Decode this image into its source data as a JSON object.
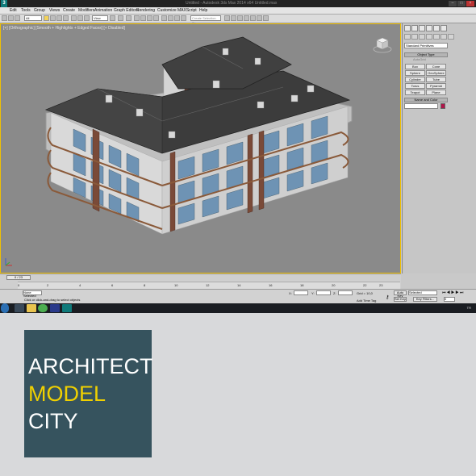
{
  "titlebar": {
    "text": "Untitled - Autodesk 3ds Max 2014 x64   Untitled.max"
  },
  "menu": [
    "Edit",
    "Tools",
    "Group",
    "Views",
    "Create",
    "Modifiers",
    "Animation",
    "Graph Editors",
    "Rendering",
    "Customize",
    "MAXScript",
    "Help"
  ],
  "toolbar": {
    "filter_value": "All",
    "refcoord_value": "View",
    "selection_set_placeholder": "Create Selection Se"
  },
  "viewport": {
    "label": "[+] [Orthographic] [Smooth + Highlights + Edged Faces] [+ Disabled]"
  },
  "command_panel": {
    "dropdown": "Standard Primitives",
    "object_type_title": "Object Type",
    "autogrid_label": "AutoGrid",
    "buttons": [
      "Box",
      "Cone",
      "Sphere",
      "GeoSphere",
      "Cylinder",
      "Tube",
      "Torus",
      "Pyramid",
      "Teapot",
      "Plane"
    ],
    "name_color_title": "Name and Color",
    "color": "#b0164a"
  },
  "timeline": {
    "slider": "0 / 23",
    "ticks": [
      "0",
      "2",
      "4",
      "6",
      "8",
      "10",
      "12",
      "14",
      "16",
      "18",
      "20",
      "22",
      "23"
    ]
  },
  "status": {
    "selection": "None Selected",
    "prompt": "Click or click-and-drag to select objects",
    "x_label": "X:",
    "y_label": "Y:",
    "z_label": "Z:",
    "grid": "Grid = 10,0",
    "add_time_tag": "Add Time Tag",
    "auto_key": "Auto Key",
    "set_key": "Set Key",
    "selected": "Selected",
    "key_filters": "Key Filters...",
    "frame": "0"
  },
  "taskbar": {
    "clock": "TR"
  },
  "logo": {
    "line1": "ARCHITECT",
    "line2": "MODEL",
    "line3": "CITY",
    "bg": "#36535e",
    "accent": "#f0d000"
  }
}
